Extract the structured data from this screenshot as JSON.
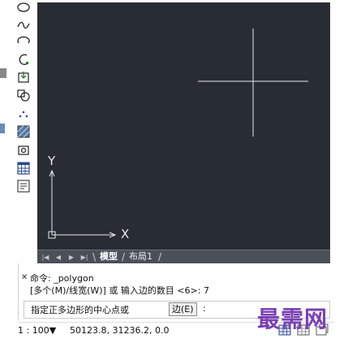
{
  "toolbar": {
    "tools": [
      {
        "name": "ellipse-icon"
      },
      {
        "name": "spline-icon"
      },
      {
        "name": "ellipse-arc-icon"
      },
      {
        "name": "arc-icon"
      },
      {
        "name": "insert-block-icon"
      },
      {
        "name": "make-block-icon"
      },
      {
        "name": "point-icon"
      },
      {
        "name": "hatch-icon"
      },
      {
        "name": "region-icon"
      },
      {
        "name": "table-icon"
      },
      {
        "name": "multiline-text-icon"
      }
    ]
  },
  "viewport": {
    "background": "#282c34",
    "crosshair_color": "#e8e8e8",
    "y_axis_label": "Y",
    "x_axis_label": "X"
  },
  "tabs": {
    "model_label": "模型",
    "layout1_label": "布局1"
  },
  "command": {
    "line1": "命令: _polygon",
    "line2": "[多个(M)/线宽(W)] 或 输入边的数目 <6>: 7",
    "prompt_text": "指定正多边形的中心点或",
    "edge_option": "边(E)",
    "prompt_colon": ":"
  },
  "status": {
    "scale": "1 : 100▼",
    "coordinates": "50123.8, 31236.2, 0.0"
  },
  "watermark": {
    "text": "最需网",
    "color": "#7a3fb5"
  }
}
